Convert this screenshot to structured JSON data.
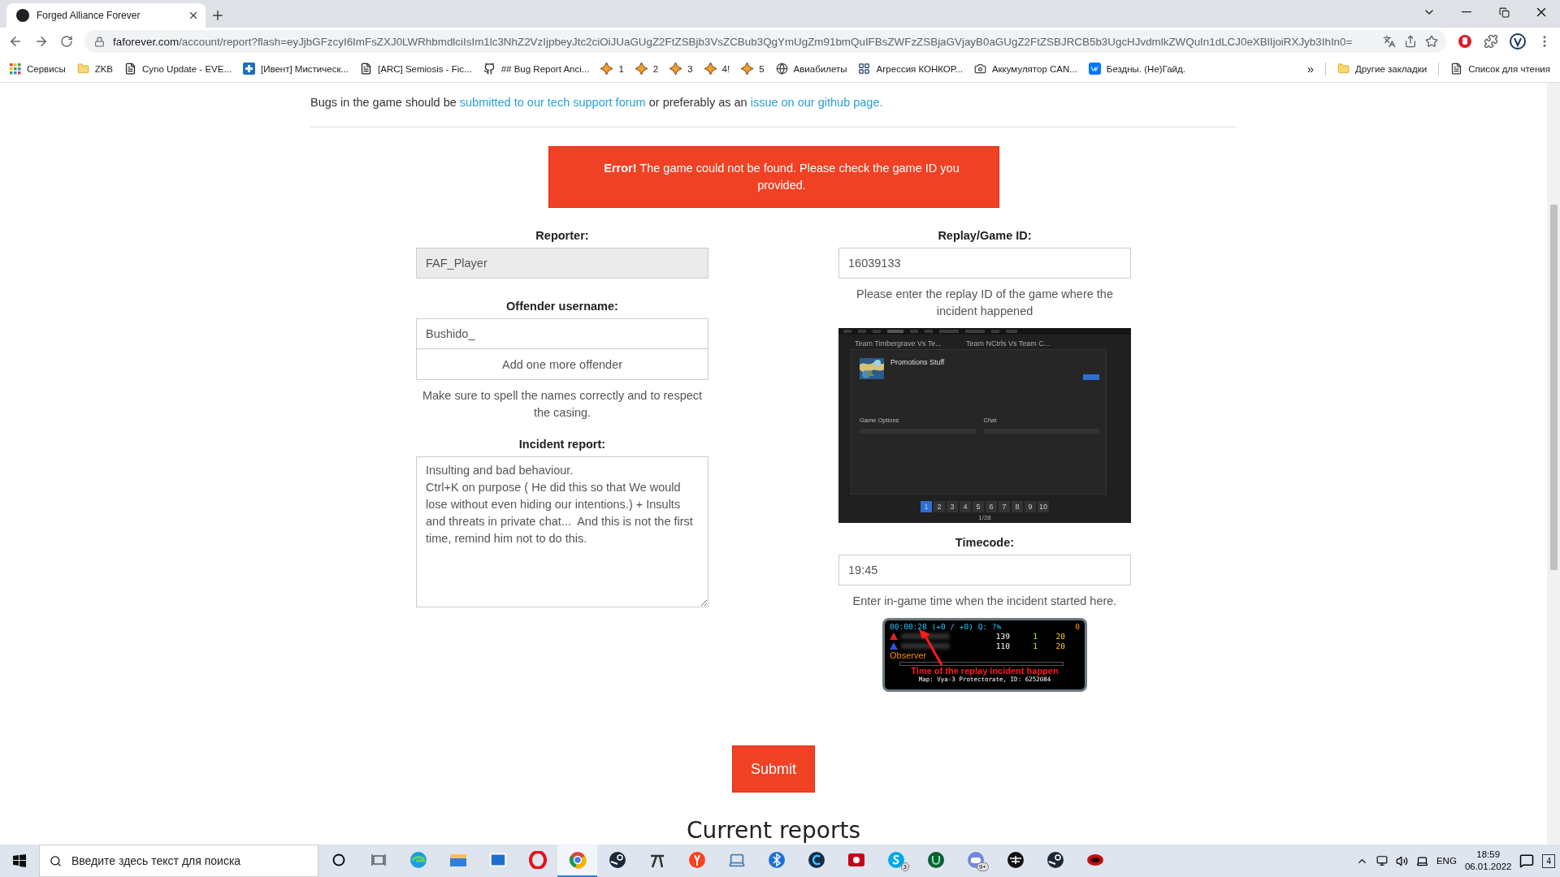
{
  "browser": {
    "tab": {
      "title": "Forged Alliance Forever",
      "selected": true
    },
    "url": {
      "host": "faforever.com",
      "path": "/account/report?flash=eyJjbGFzcyI6ImFsZXJ0LWRhbmdlciIsIm1lc3NhZ2VzIjpbeyJtc2ciOiJUaGUgZ2FtZSBjb3VsZCBub3QgYmUgZm91bmQuIFBsZWFzZSBjaGVjayB0aGUgZ2FtZSBJRCB5b3UgcHJvdmlkZWQuIn1dLCJ0eXBlIjoiRXJyb3IhIn0="
    },
    "bookmarks": [
      {
        "kind": "apps",
        "label": "Сервисы"
      },
      {
        "kind": "folder",
        "label": "ZKB"
      },
      {
        "kind": "doc",
        "label": "Cyno Update - EVE..."
      },
      {
        "kind": "cross",
        "label": "[Ивент] Мистическ..."
      },
      {
        "kind": "doc",
        "label": "[ARC] Semiosis - Fic..."
      },
      {
        "kind": "github",
        "label": "## Bug Report Anci..."
      },
      {
        "kind": "star",
        "label": "1"
      },
      {
        "kind": "star",
        "label": "2"
      },
      {
        "kind": "star",
        "label": "3"
      },
      {
        "kind": "star",
        "label": "4!"
      },
      {
        "kind": "star",
        "label": "5"
      },
      {
        "kind": "globe",
        "label": "Авиабилеты"
      },
      {
        "kind": "grid",
        "label": "Агрессия КОНКОР..."
      },
      {
        "kind": "camera",
        "label": "Аккумулятор CAN..."
      },
      {
        "kind": "vk",
        "label": "Бездны. (Не)Гайд."
      }
    ],
    "overflow": "»",
    "other_bookmarks": "Другие закладки",
    "reading_list": "Список для чтения"
  },
  "page": {
    "notice": {
      "before": "Bugs in the game should be ",
      "link_1": "submitted to our tech support forum",
      "middle": " or preferably as an ",
      "link_2": "issue on our github page."
    },
    "error": "**Error!** The game could not be found. Please check the game ID you provided.",
    "reporter": {
      "label": "Reporter:",
      "value": "FAF_Player",
      "disabled": true
    },
    "offender": {
      "label": "Offender username:",
      "value": "Bushido_",
      "add_button": "Add one more offender",
      "help": "Make sure to spell the names correctly and to respect the casing."
    },
    "incident": {
      "label": "Incident report:",
      "value": "Insulting and bad behaviour.\nCtrl+K on purpose ( He did this so that We would lose without even hiding our intentions.) + Insults and threats in private chat...  And this is not the first time, remind him not to do this."
    },
    "replay": {
      "label": "Replay/Game ID:",
      "value": "16039133",
      "help": "Please enter the replay ID of the game where the incident happened"
    },
    "replay_screenshot": {
      "cards": [
        "Team Timbergrave Vs Te...",
        "Team NCtrls Vs Team C..."
      ],
      "title": "Promotions Stuff",
      "sections": [
        "Game Options",
        "Chat"
      ],
      "pages": [
        {
          "label": "1",
          "selected": true
        },
        {
          "label": "2",
          "selected": false
        },
        {
          "label": "3",
          "selected": false
        },
        {
          "label": "4",
          "selected": false
        },
        {
          "label": "5",
          "selected": false
        },
        {
          "label": "6",
          "selected": false
        },
        {
          "label": "7",
          "selected": false
        },
        {
          "label": "8",
          "selected": false
        },
        {
          "label": "9",
          "selected": false
        },
        {
          "label": "10",
          "selected": false
        }
      ],
      "page_count": "1/28"
    },
    "timecode": {
      "label": "Timecode:",
      "value": "19:45",
      "help": "Enter in-game time when the incident started here."
    },
    "hud_screenshot": {
      "clock": "00:00:28 (+0 / +0) Q: ?%",
      "units": "0",
      "players": [
        {
          "score": "139",
          "count": "1",
          "mass": "20",
          "color": "#e02020"
        },
        {
          "score": "110",
          "count": "1",
          "mass": "20",
          "color": "#3050e0"
        }
      ],
      "observer": "Observer",
      "caption": "Time of the replay incident happen",
      "map": "Map: Vya-3 Protectorate, ID: 6252084"
    },
    "submit": "Submit",
    "heading": "Current reports"
  },
  "taskbar": {
    "search": {
      "placeholder": "Введите здесь текст для поиска"
    },
    "apps": [
      {
        "kind": "ring",
        "selected": false
      },
      {
        "kind": "taskview",
        "selected": false
      },
      {
        "kind": "edge",
        "selected": false
      },
      {
        "kind": "folder",
        "selected": false
      },
      {
        "kind": "mail",
        "selected": false
      },
      {
        "kind": "opera",
        "selected": false
      },
      {
        "kind": "chrome",
        "selected": true
      },
      {
        "kind": "steam",
        "selected": false
      },
      {
        "kind": "feather",
        "selected": false
      },
      {
        "kind": "yandex",
        "selected": false
      },
      {
        "kind": "laptop",
        "selected": false
      },
      {
        "kind": "bluetooth",
        "selected": false
      },
      {
        "kind": "ccircle",
        "selected": false
      },
      {
        "kind": "record",
        "selected": false
      },
      {
        "kind": "skype",
        "selected": false,
        "badge": "3"
      },
      {
        "kind": "upwork",
        "selected": false
      },
      {
        "kind": "discord",
        "selected": false,
        "badge": "9+"
      },
      {
        "kind": "faf",
        "selected": false
      },
      {
        "kind": "steam",
        "selected": false
      },
      {
        "kind": "redgame",
        "selected": false
      }
    ],
    "language": "ENG",
    "time": "18:59",
    "date": "06.01.2022",
    "notifications": "4"
  }
}
